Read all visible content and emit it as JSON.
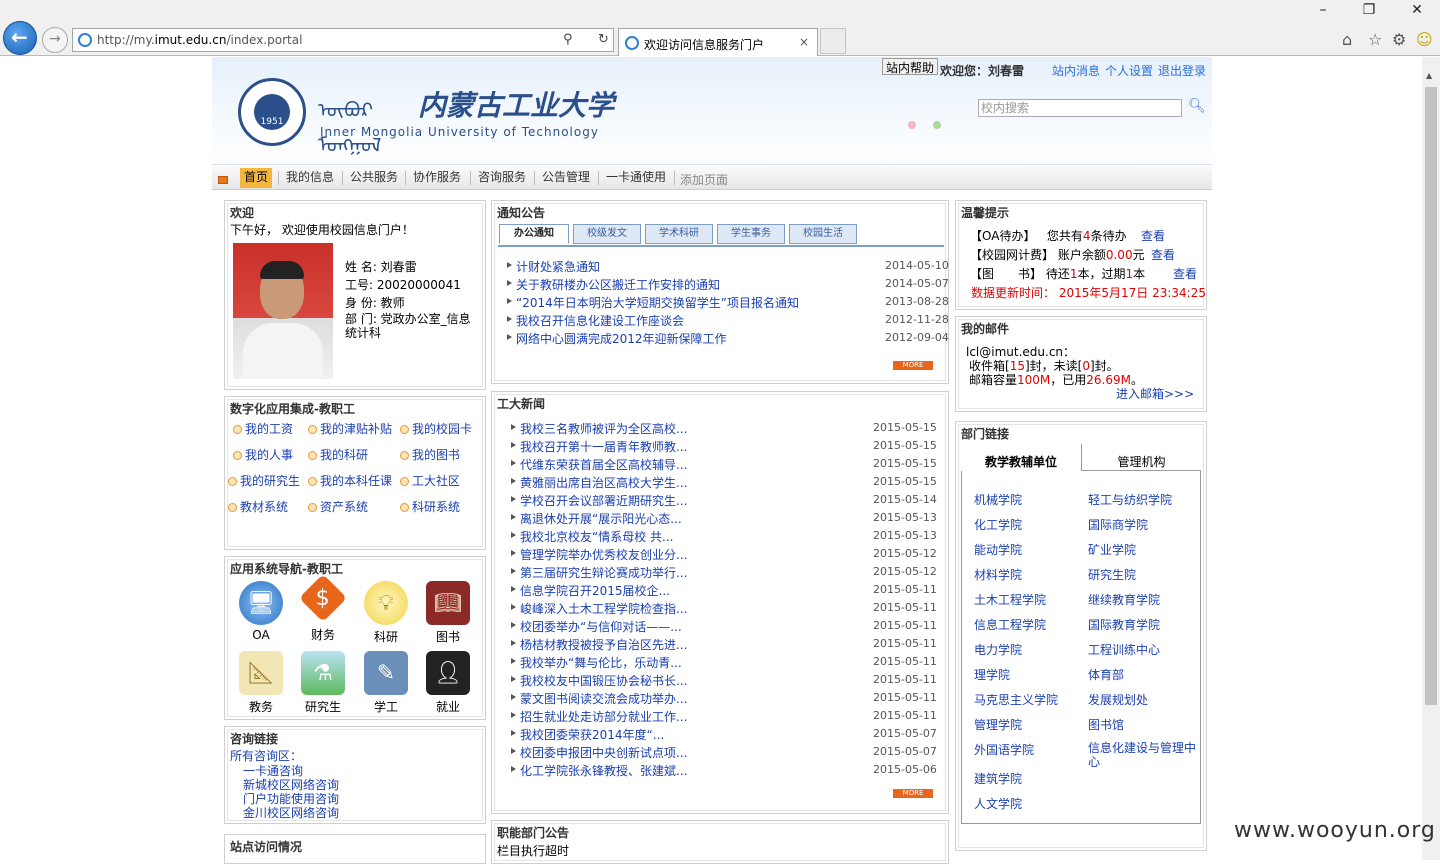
{
  "browser": {
    "url_prefix": "http://my.",
    "url_domain": "imut.edu.cn",
    "url_path": "/index.portal",
    "tab_title": "欢迎访问信息服务门户",
    "tab_close": "×"
  },
  "header": {
    "mongolian": "ᠥᠪᠥᠷ ᠮᠣᠩᠭᠣᠯ",
    "school_cn": "内蒙古工业大学",
    "school_en": "Inner Mongolia University of Technology",
    "logo_year": "1951",
    "help": "站内帮助",
    "welcome": "欢迎您：刘春雷",
    "links": [
      "站内消息",
      "个人设置",
      "退出登录"
    ],
    "search_placeholder": "校内搜索"
  },
  "nav": {
    "items": [
      "首页",
      "我的信息",
      "公共服务",
      "协作服务",
      "咨询服务",
      "公告管理",
      "一卡通使用"
    ],
    "add": "添加页面"
  },
  "welcome_box": {
    "title": "欢迎",
    "greeting": "下午好， 欢迎使用校园信息门户！",
    "name": "姓 名: 刘春雷",
    "id": "工号: 20020000041",
    "role": "身 份: 教师",
    "dept": "部 门: 党政办公室_信息统计科"
  },
  "digital": {
    "title": "数字化应用集成-教职工",
    "items": [
      "我的工资",
      "我的津贴补贴",
      "我的校园卡",
      "我的人事",
      "我的科研",
      "我的图书",
      "我的研究生",
      "我的本科任课",
      "工大社区",
      "教材系统",
      "资产系统",
      "科研系统"
    ]
  },
  "apps": {
    "title": "应用系统导航-教职工",
    "items": [
      "OA",
      "财务",
      "科研",
      "图书",
      "教务",
      "研究生",
      "学工",
      "就业"
    ]
  },
  "consult": {
    "title": "咨询链接",
    "label": "所有咨询区：",
    "items": [
      "一卡通咨询",
      "新城校区网络咨询",
      "门户功能使用咨询",
      "金川校区网络咨询"
    ]
  },
  "visits": {
    "title": "站点访问情况"
  },
  "notice": {
    "title": "通知公告",
    "tabs": [
      "办公通知",
      "校级发文",
      "学术科研",
      "学生事务",
      "校园生活"
    ],
    "items": [
      {
        "t": "计财处紧急通知",
        "d": "2014-05-10"
      },
      {
        "t": "关于教研楼办公区搬迁工作安排的通知",
        "d": "2014-05-07"
      },
      {
        "t": "“2014年日本明治大学短期交换留学生”项目报名通知",
        "d": "2013-08-28"
      },
      {
        "t": "我校召开信息化建设工作座谈会",
        "d": "2012-11-28"
      },
      {
        "t": "网络中心圆满完成2012年迎新保障工作",
        "d": "2012-09-04"
      }
    ],
    "more": "MORE"
  },
  "news": {
    "title": "工大新闻",
    "items": [
      {
        "t": "我校三名教师被评为全区高校...",
        "d": "2015-05-15"
      },
      {
        "t": "我校召开第十一届青年教师教...",
        "d": "2015-05-15"
      },
      {
        "t": "代维东荣获首届全区高校辅导...",
        "d": "2015-05-15"
      },
      {
        "t": "黄雅丽出席自治区高校大学生...",
        "d": "2015-05-15"
      },
      {
        "t": "学校召开会议部署近期研究生...",
        "d": "2015-05-14"
      },
      {
        "t": "离退休处开展“展示阳光心态...",
        "d": "2015-05-13"
      },
      {
        "t": "我校北京校友“情系母校 共...",
        "d": "2015-05-13"
      },
      {
        "t": "管理学院举办优秀校友创业分...",
        "d": "2015-05-12"
      },
      {
        "t": "第三届研究生辩论赛成功举行...",
        "d": "2015-05-12"
      },
      {
        "t": "信息学院召开2015届校企...",
        "d": "2015-05-11"
      },
      {
        "t": "峻峰深入土木工程学院检查指...",
        "d": "2015-05-11"
      },
      {
        "t": "校团委举办“与信仰对话——...",
        "d": "2015-05-11"
      },
      {
        "t": "杨桔材教授被授予自治区先进...",
        "d": "2015-05-11"
      },
      {
        "t": "我校举办“舞与伦比，乐动青...",
        "d": "2015-05-11"
      },
      {
        "t": "我校校友中国锻压协会秘书长...",
        "d": "2015-05-11"
      },
      {
        "t": "蒙文图书阅读交流会成功举办...",
        "d": "2015-05-11"
      },
      {
        "t": "招生就业处走访部分就业工作...",
        "d": "2015-05-11"
      },
      {
        "t": "我校团委荣获2014年度“...",
        "d": "2015-05-07"
      },
      {
        "t": "校团委申报团中央创新试点项...",
        "d": "2015-05-07"
      },
      {
        "t": "化工学院张永锋教授、张建斌...",
        "d": "2015-05-06"
      }
    ],
    "more": "MORE"
  },
  "dept_notice": {
    "title": "职能部门公告",
    "content": "栏目执行超时"
  },
  "tips": {
    "title": "温馨提示",
    "oa_label": "【OA待办】",
    "oa_pre": "您共有",
    "oa_count": "4",
    "oa_post": "条待办",
    "net_label": "【校园网计费】",
    "net_pre": "账户余额",
    "net_amount": "0.00",
    "net_unit": "元",
    "lib_label": "【图　　书】",
    "lib_pre": "待还",
    "lib_due": "1",
    "lib_mid": "本，过期",
    "lib_over": "1",
    "lib_unit": "本",
    "view": "查看",
    "update": "数据更新时间： 2015年5月17日 23:34:25"
  },
  "mail": {
    "title": "我的邮件",
    "addr": "lcl@imut.edu.cn：",
    "inbox_pre": "收件箱[",
    "inbox": "15",
    "inbox_mid": "]封，未读[",
    "unread": "0",
    "inbox_post": "]封。",
    "cap_pre": "邮箱容量",
    "capacity": "100M",
    "cap_mid": "，已用",
    "used": "26.69M",
    "cap_post": "。",
    "enter": "进入邮箱>>>"
  },
  "depts": {
    "title": "部门链接",
    "tabs": [
      "教学教辅单位",
      "管理机构"
    ],
    "left": [
      "机械学院",
      "化工学院",
      "能动学院",
      "材料学院",
      "土木工程学院",
      "信息工程学院",
      "电力学院",
      "理学院",
      "马克思主义学院",
      "管理学院",
      "外国语学院",
      "建筑学院",
      "人文学院"
    ],
    "right": [
      "轻工与纺织学院",
      "国际商学院",
      "矿业学院",
      "研究生院",
      "继续教育学院",
      "国际教育学院",
      "工程训练中心",
      "体育部",
      "发展规划处",
      "图书馆",
      "信息化建设与管理中心"
    ]
  },
  "watermark": "www.wooyun.org",
  "colors": {
    "accent": "#f4b63e",
    "link": "#1a3fb0",
    "alert": "#e00000",
    "brand": "#2a4f8a"
  }
}
